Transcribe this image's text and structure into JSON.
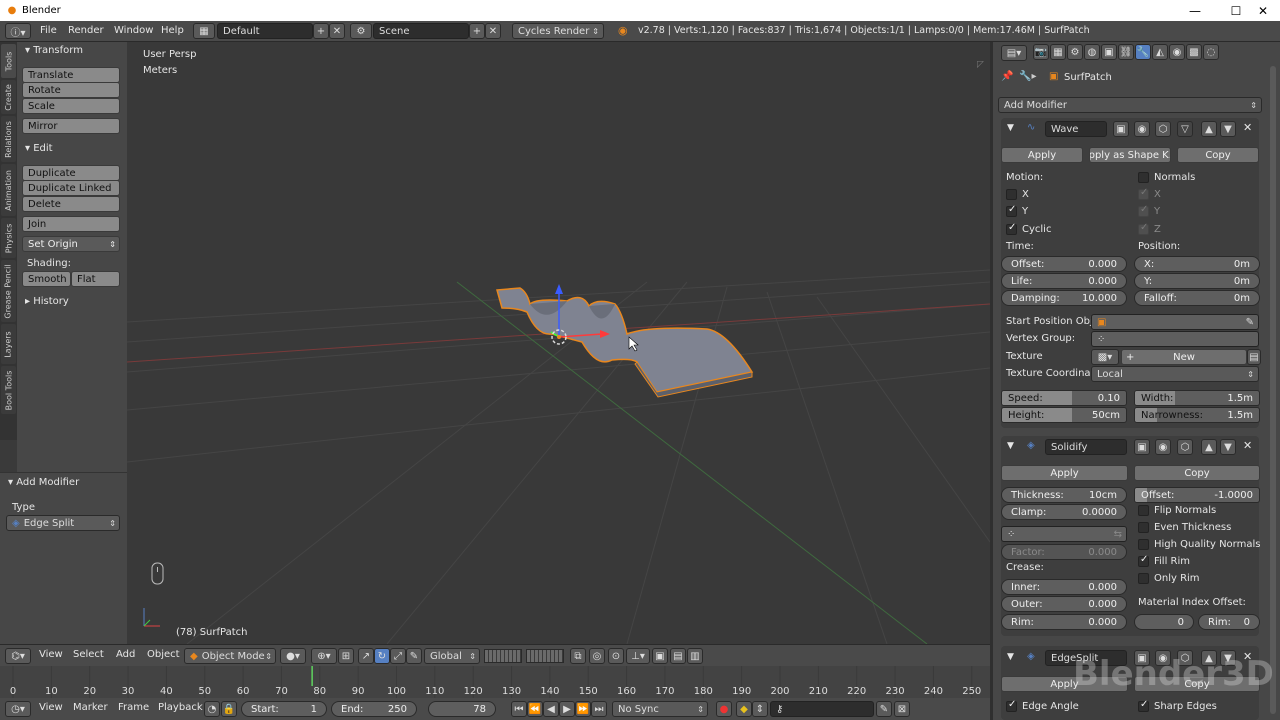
{
  "window": {
    "title": "Blender"
  },
  "menubar": {
    "items": [
      "File",
      "Render",
      "Window",
      "Help"
    ],
    "layout": "Default",
    "scene": "Scene",
    "engine": "Cycles Render",
    "stats": "v2.78 | Verts:1,120 | Faces:837 | Tris:1,674 | Objects:1/1 | Lamps:0/0 | Mem:17.46M | SurfPatch"
  },
  "left_tabs": [
    "Tools",
    "Create",
    "Relations",
    "Animation",
    "Physics",
    "Grease Pencil",
    "Layers",
    "Bool Tools"
  ],
  "toolshelf": {
    "transform_header": "Transform",
    "transform_buttons": [
      "Translate",
      "Rotate",
      "Scale"
    ],
    "mirror": "Mirror",
    "edit_header": "Edit",
    "edit_buttons": [
      "Duplicate",
      "Duplicate Linked",
      "Delete"
    ],
    "join": "Join",
    "set_origin": "Set Origin",
    "shading_label": "Shading:",
    "smooth": "Smooth",
    "flat": "Flat",
    "history_header": "History"
  },
  "operator": {
    "header": "Add Modifier",
    "type_label": "Type",
    "type_value": "Edge Split"
  },
  "viewport": {
    "view_name": "User Persp",
    "units": "Meters",
    "object_label": "(78) SurfPatch"
  },
  "view_header": {
    "menus": [
      "View",
      "Select",
      "Add",
      "Object"
    ],
    "mode": "Object Mode",
    "orientation": "Global"
  },
  "timeline": {
    "ticks": [
      "0",
      "10",
      "20",
      "30",
      "40",
      "50",
      "60",
      "70",
      "80",
      "90",
      "100",
      "110",
      "120",
      "130",
      "140",
      "150",
      "160",
      "170",
      "180",
      "190",
      "200",
      "210",
      "220",
      "230",
      "240",
      "250"
    ],
    "menus": [
      "View",
      "Marker",
      "Frame",
      "Playback"
    ],
    "start_label": "Start:",
    "start": "1",
    "end_label": "End:",
    "end": "250",
    "current": "78",
    "sync": "No Sync",
    "current_frame_value": 78,
    "frame_max": 250
  },
  "properties": {
    "object_name": "SurfPatch",
    "add_modifier": "Add Modifier",
    "wave": {
      "name": "Wave",
      "apply": "Apply",
      "apply_shape": "Apply as Shape K...",
      "copy": "Copy",
      "motion_label": "Motion:",
      "x": "X",
      "y": "Y",
      "cyclic": "Cyclic",
      "normals": "Normals",
      "nx": "X",
      "ny": "Y",
      "nz": "Z",
      "time_label": "Time:",
      "position_label": "Position:",
      "offset_label": "Offset:",
      "offset": "0.000",
      "life_label": "Life:",
      "life": "0.000",
      "damping_label": "Damping:",
      "damping": "10.000",
      "px_label": "X:",
      "px": "0m",
      "py_label": "Y:",
      "py": "0m",
      "falloff_label": "Falloff:",
      "falloff": "0m",
      "start_pos_label": "Start Position Obj...",
      "vgroup_label": "Vertex Group:",
      "texture_label": "Texture",
      "texture_new": "New",
      "tex_coord_label": "Texture Coordina...",
      "tex_coord": "Local",
      "speed_label": "Speed:",
      "speed": "0.10",
      "height_label": "Height:",
      "height": "50cm",
      "width_label": "Width:",
      "width": "1.5m",
      "narrow_label": "Narrowness:",
      "narrow": "1.5m"
    },
    "solidify": {
      "name": "Solidify",
      "apply": "Apply",
      "copy": "Copy",
      "thickness_label": "Thickness:",
      "thickness": "10cm",
      "offset_label": "Offset:",
      "offset": "-1.0000",
      "clamp_label": "Clamp:",
      "clamp": "0.0000",
      "flip": "Flip Normals",
      "even": "Even Thickness",
      "hq": "High Quality Normals",
      "fill_rim": "Fill Rim",
      "only_rim": "Only Rim",
      "factor_label": "Factor:",
      "factor": "0.000",
      "crease_label": "Crease:",
      "inner_label": "Inner:",
      "inner": "0.000",
      "outer_label": "Outer:",
      "outer": "0.000",
      "rim_label": "Rim:",
      "rim": "0.000",
      "mat_offset_label": "Material Index Offset:",
      "mat_offset": "0",
      "mat_rim_label": "Rim:",
      "mat_rim": "0"
    },
    "edgesplit": {
      "name": "EdgeSplit",
      "apply": "Apply",
      "copy": "Copy",
      "edge_angle": "Edge Angle",
      "sharp_edges": "Sharp Edges"
    }
  },
  "watermark": "Blender3D",
  "colors": {
    "accent_orange": "#e8871e",
    "selection_blue": "#5680c2"
  }
}
